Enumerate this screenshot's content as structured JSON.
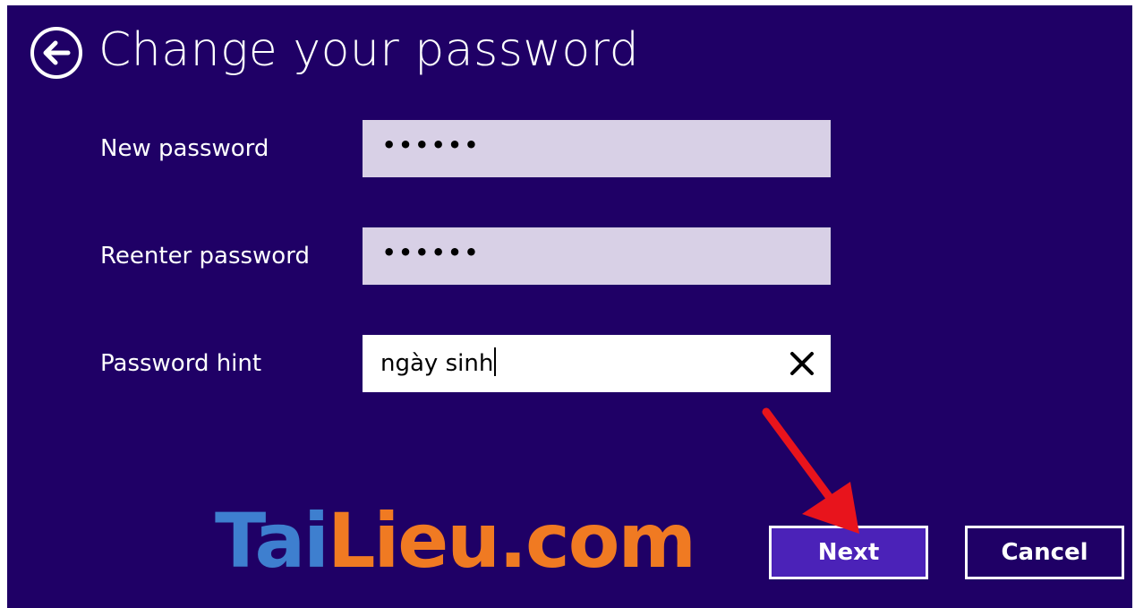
{
  "window": {
    "title": "Change your password"
  },
  "form": {
    "new_password": {
      "label": "New password",
      "value": "••••••"
    },
    "reenter_password": {
      "label": "Reenter password",
      "value": "••••••"
    },
    "password_hint": {
      "label": "Password hint",
      "value": "ngày sinh"
    }
  },
  "buttons": {
    "next_label": "Next",
    "cancel_label": "Cancel"
  },
  "watermark": {
    "part1": "T",
    "part2": "ai",
    "part3": "Lieu",
    "part4": ".com"
  },
  "colors": {
    "background": "#1f0066",
    "field_password": "#d8d0e6",
    "field_hint": "#ffffff",
    "next_button": "#4b22b8",
    "annotation_arrow": "#e8141c"
  },
  "icons": {
    "back": "back-arrow-circle-icon",
    "clear": "close-icon"
  }
}
